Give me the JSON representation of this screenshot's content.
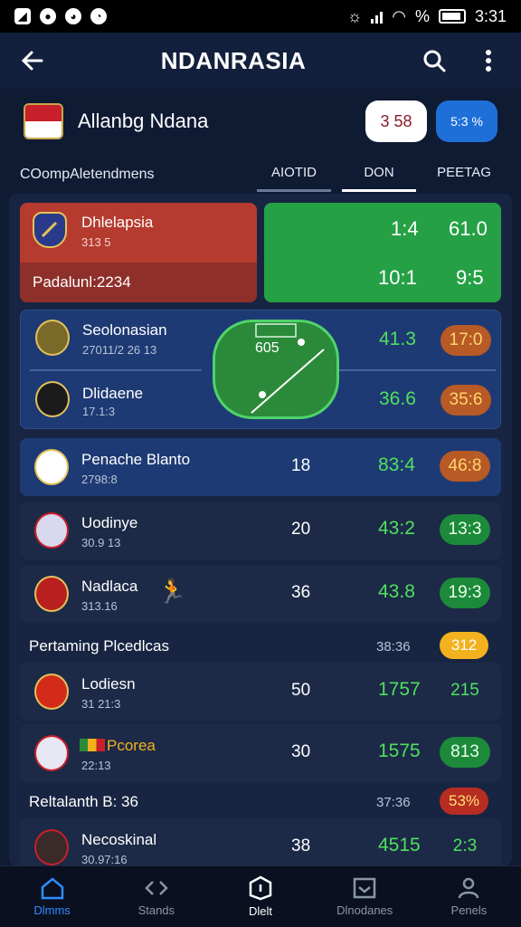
{
  "statusbar": {
    "time": "3:31"
  },
  "appbar": {
    "title": "NDANRASIA"
  },
  "team": {
    "name": "Allanbg Ndana",
    "pill_white": "3 58",
    "pill_blue": "5:3 %"
  },
  "tabs": {
    "left_label": "COompAletendmens",
    "items": [
      "AIOTID",
      "DON",
      "PEETAG"
    ]
  },
  "top_cards": {
    "red": {
      "title": "Dhlelapsia",
      "sub": "313 5",
      "band": "Padalunl:2234"
    },
    "green": {
      "r1c1": "1:4",
      "r1c2": "61.0",
      "r2c1": "10:1",
      "r2c2": "9:5"
    }
  },
  "match": {
    "team1": {
      "name": "Seolonasian",
      "sub": "27011/2 26 13",
      "val": "41.3",
      "badge": "17:0"
    },
    "team2": {
      "name": "Dlidaene",
      "sub": "17.1:3",
      "val": "36.6",
      "badge": "35:6"
    },
    "pitch_label": "605"
  },
  "rows": [
    {
      "name": "Penache Blanto",
      "sub": "2798:8",
      "mid": "18",
      "val": "83:4",
      "badge": "46:8",
      "badge_style": "orange"
    },
    {
      "name": "Uodinye",
      "sub": "30.9 13",
      "mid": "20",
      "val": "43:2",
      "badge": "13:3",
      "badge_style": "green"
    },
    {
      "name": "Nadlaca",
      "sub": "313.16",
      "mid": "36",
      "val": "43.8",
      "badge": "19:3",
      "badge_style": "green"
    }
  ],
  "section1": {
    "label": "Pertaming Plcedlcas",
    "val": "38:36",
    "badge": "312"
  },
  "rows2": [
    {
      "name": "Lodiesn",
      "sub": "31 21:3",
      "mid": "50",
      "val": "1757",
      "badge": "215",
      "badge_style": "plain"
    },
    {
      "name": "Pcorea",
      "sub": "22:13",
      "mid": "30",
      "val": "1575",
      "badge": "813",
      "badge_style": "green"
    }
  ],
  "section2": {
    "label": "Reltalanth B: 36",
    "val": "37:36",
    "badge": "53%"
  },
  "rows3": [
    {
      "name": "Necoskinal",
      "sub": "30.97:16",
      "mid": "38",
      "val": "4515",
      "badge": "2:3",
      "badge_style": "plain"
    }
  ],
  "nav": [
    "Dlmms",
    "Stands",
    "Dlelt",
    "Dlnodanes",
    "Penels"
  ],
  "colors": {
    "accent_green": "#4fe05e",
    "brand_blue": "#1f6fd8",
    "bg": "#0f1a33"
  }
}
